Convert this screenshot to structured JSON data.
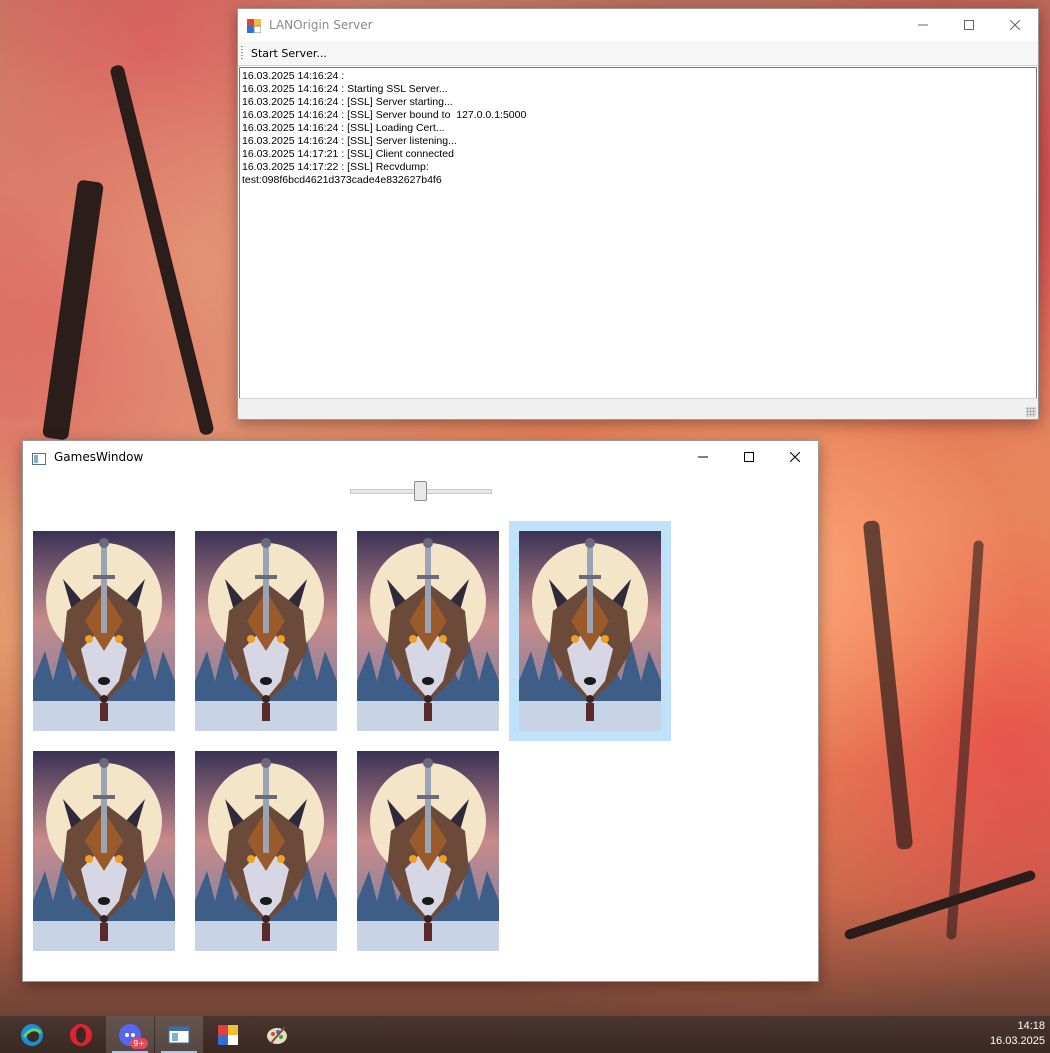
{
  "server_window": {
    "title": "LANOrigin Server",
    "menu": {
      "start_server": "Start Server..."
    },
    "log": [
      "16.03.2025 14:16:24 :",
      "16.03.2025 14:16:24 : Starting SSL Server...",
      "16.03.2025 14:16:24 : [SSL] Server starting...",
      "16.03.2025 14:16:24 : [SSL] Server bound to  127.0.0.1:5000",
      "16.03.2025 14:16:24 : [SSL] Loading Cert...",
      "16.03.2025 14:16:24 : [SSL] Server listening...",
      "16.03.2025 14:17:21 : [SSL] Client connected",
      "16.03.2025 14:17:22 : [SSL] Recvdump:",
      "test:098f6bcd4621d373cade4e832627b4f6"
    ]
  },
  "games_window": {
    "title": "GamesWindow",
    "slider": {
      "value": 0.5
    },
    "games": [
      {
        "icon": "wolf-cover-art",
        "selected": false
      },
      {
        "icon": "wolf-cover-art",
        "selected": false
      },
      {
        "icon": "wolf-cover-art",
        "selected": false
      },
      {
        "icon": "wolf-cover-art",
        "selected": true
      },
      {
        "icon": "wolf-cover-art",
        "selected": false
      },
      {
        "icon": "wolf-cover-art",
        "selected": false
      },
      {
        "icon": "wolf-cover-art",
        "selected": false
      }
    ]
  },
  "taskbar": {
    "apps": [
      {
        "icon": "edge-icon",
        "active": false
      },
      {
        "icon": "opera-icon",
        "active": false
      },
      {
        "icon": "discord-icon",
        "active": true,
        "badge": "9+"
      },
      {
        "icon": "games-window-icon",
        "active": true
      },
      {
        "icon": "lanorigin-icon",
        "active": false
      },
      {
        "icon": "paint-icon",
        "active": false
      }
    ],
    "time": "14:18",
    "date": "16.03.2025"
  },
  "colors": {
    "selection": "#bfe2fa",
    "taskbar": "#3b2a24"
  }
}
